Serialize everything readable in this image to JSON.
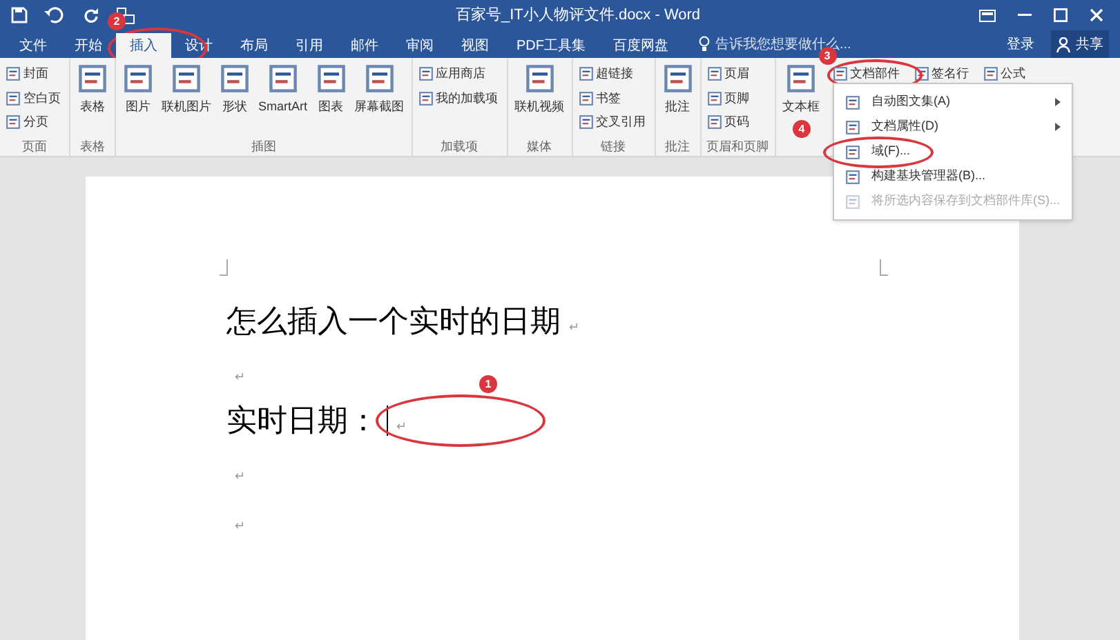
{
  "window": {
    "title": "百家号_IT小人物评文件.docx - Word"
  },
  "tabs": [
    {
      "label": "文件",
      "selected": false
    },
    {
      "label": "开始",
      "selected": false
    },
    {
      "label": "插入",
      "selected": true,
      "annotation": "2"
    },
    {
      "label": "设计",
      "selected": false
    },
    {
      "label": "布局",
      "selected": false
    },
    {
      "label": "引用",
      "selected": false
    },
    {
      "label": "邮件",
      "selected": false
    },
    {
      "label": "审阅",
      "selected": false
    },
    {
      "label": "视图",
      "selected": false
    },
    {
      "label": "PDF工具集",
      "selected": false
    },
    {
      "label": "百度网盘",
      "selected": false
    }
  ],
  "search": {
    "placeholder": "告诉我您想要做什么..."
  },
  "account": {
    "sign_in": "登录",
    "share": "共享"
  },
  "ribbon": {
    "groups": [
      {
        "label": "页面",
        "items": [
          {
            "label": "封面",
            "kind": "small"
          },
          {
            "label": "空白页",
            "kind": "small"
          },
          {
            "label": "分页",
            "kind": "small"
          }
        ]
      },
      {
        "label": "表格",
        "items": [
          {
            "label": "表格",
            "kind": "large"
          }
        ]
      },
      {
        "label": "插图",
        "items": [
          {
            "label": "图片",
            "kind": "large"
          },
          {
            "label": "联机图片",
            "kind": "large"
          },
          {
            "label": "形状",
            "kind": "large"
          },
          {
            "label": "SmartArt",
            "kind": "large"
          },
          {
            "label": "图表",
            "kind": "large"
          },
          {
            "label": "屏幕截图",
            "kind": "large"
          }
        ]
      },
      {
        "label": "加载项",
        "items": [
          {
            "label": "应用商店",
            "kind": "small"
          },
          {
            "label": "我的加载项",
            "kind": "small"
          }
        ]
      },
      {
        "label": "媒体",
        "items": [
          {
            "label": "联机视频",
            "kind": "large"
          }
        ]
      },
      {
        "label": "链接",
        "items": [
          {
            "label": "超链接",
            "kind": "small"
          },
          {
            "label": "书签",
            "kind": "small"
          },
          {
            "label": "交叉引用",
            "kind": "small"
          }
        ]
      },
      {
        "label": "批注",
        "items": [
          {
            "label": "批注",
            "kind": "large"
          }
        ]
      },
      {
        "label": "页眉和页脚",
        "items": [
          {
            "label": "页眉",
            "kind": "small"
          },
          {
            "label": "页脚",
            "kind": "small"
          },
          {
            "label": "页码",
            "kind": "small"
          }
        ]
      },
      {
        "items": [
          {
            "label": "文本框",
            "kind": "large"
          }
        ]
      },
      {
        "items": [
          {
            "label": "文档部件",
            "kind": "small",
            "annotation": "3"
          }
        ]
      },
      {
        "items": [
          {
            "label": "签名行",
            "kind": "small"
          }
        ]
      },
      {
        "items": [
          {
            "label": "公式",
            "kind": "small"
          }
        ]
      }
    ]
  },
  "menu": {
    "items": [
      {
        "label": "自动图文集(A)",
        "disabled": false,
        "submenu": true
      },
      {
        "label": "文档属性(D)",
        "disabled": false,
        "submenu": true
      },
      {
        "label": "域(F)...",
        "disabled": false,
        "submenu": false,
        "annotation": "4"
      },
      {
        "label": "构建基块管理器(B)...",
        "disabled": false,
        "submenu": false
      },
      {
        "label": "将所选内容保存到文档部件库(S)...",
        "disabled": true,
        "submenu": false
      }
    ]
  },
  "document": {
    "paragraphs": [
      {
        "kind": "heading",
        "text": "怎么插入一个实时的日期",
        "mark": "↵"
      },
      {
        "kind": "empty",
        "mark": "↵"
      },
      {
        "kind": "field",
        "text": "实时日期：",
        "mark": "↵",
        "annotation": "1"
      },
      {
        "kind": "empty",
        "mark": "↵"
      },
      {
        "kind": "empty",
        "mark": "↵"
      }
    ]
  }
}
